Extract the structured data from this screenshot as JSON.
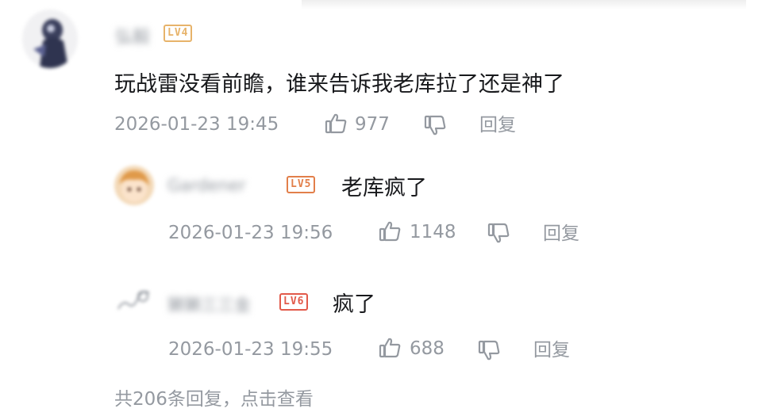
{
  "comment": {
    "username": "弘毅",
    "level": "LV4",
    "text": "玩战雷没看前瞻，谁来告诉我老库拉了还是神了",
    "time": "2026-01-23 19:45",
    "likes": "977",
    "reply_label": "回复"
  },
  "replies": [
    {
      "username": "Gardener",
      "level": "LV5",
      "text": "老库疯了",
      "time": "2026-01-23 19:56",
      "likes": "1148",
      "reply_label": "回复"
    },
    {
      "username": "獭獭三三金",
      "level": "LV6",
      "text": "疯了",
      "time": "2026-01-23 19:55",
      "likes": "688",
      "reply_label": "回复"
    }
  ],
  "footer": {
    "more_replies": "共206条回复，点击查看"
  },
  "colors": {
    "text": "#18191c",
    "meta": "#9499a0",
    "lv4": "#e7b36a",
    "lv5": "#e27f4a",
    "lv6": "#e25a4a"
  }
}
